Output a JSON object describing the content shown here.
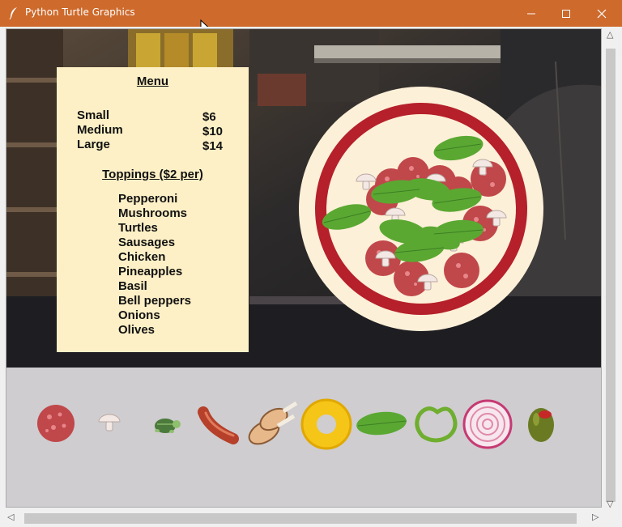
{
  "window": {
    "title": "Python Turtle Graphics",
    "icon": "feather-icon",
    "controls": [
      "minimize-icon",
      "maximize-icon",
      "close-icon"
    ]
  },
  "menu": {
    "title": "Menu",
    "sizes": [
      {
        "name": "Small",
        "price": "$6"
      },
      {
        "name": "Medium",
        "price": "$10"
      },
      {
        "name": "Large",
        "price": "$14"
      }
    ],
    "toppings_title": "Toppings ($2 per)",
    "toppings": [
      "Pepperoni",
      "Mushrooms",
      "Turtles",
      "Sausages",
      "Chicken",
      "Pineapples",
      "Basil",
      "Bell peppers",
      "Onions",
      "Olives"
    ]
  },
  "tray": {
    "items": [
      "pepperoni-icon",
      "mushroom-icon",
      "turtle-icon",
      "sausage-icon",
      "chicken-icon",
      "pineapple-icon",
      "basil-icon",
      "bell-pepper-icon",
      "onion-icon",
      "olive-icon"
    ]
  },
  "colors": {
    "titlebar": "#cd6a2c",
    "menu_bg": "#fdf0c6",
    "tray_bg": "#cfcdd0",
    "crust": "#fdf0d8",
    "sauce": "#b5202a",
    "pepperoni": "#c0474a",
    "basil": "#5aa832"
  }
}
